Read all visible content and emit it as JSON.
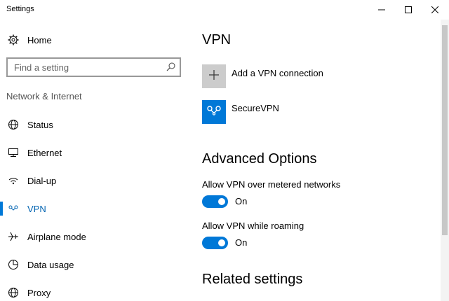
{
  "window": {
    "title": "Settings",
    "minimize_icon": "minimize-icon",
    "maximize_icon": "maximize-icon",
    "close_icon": "close-icon"
  },
  "sidebar": {
    "home_label": "Home",
    "search_placeholder": "Find a setting",
    "section_title": "Network & Internet",
    "items": [
      {
        "label": "Status",
        "icon": "globe-icon"
      },
      {
        "label": "Ethernet",
        "icon": "monitor-icon"
      },
      {
        "label": "Dial-up",
        "icon": "dialup-icon"
      },
      {
        "label": "VPN",
        "icon": "vpn-icon",
        "active": true
      },
      {
        "label": "Airplane mode",
        "icon": "airplane-icon"
      },
      {
        "label": "Data usage",
        "icon": "data-usage-icon"
      },
      {
        "label": "Proxy",
        "icon": "globe-icon"
      }
    ]
  },
  "main": {
    "title": "VPN",
    "add_label": "Add a VPN connection",
    "connection_name": "SecureVPN",
    "advanced_title": "Advanced Options",
    "options": [
      {
        "label": "Allow VPN over metered networks",
        "state": "On"
      },
      {
        "label": "Allow VPN while roaming",
        "state": "On"
      }
    ],
    "related_title": "Related settings"
  },
  "colors": {
    "accent": "#0078d7",
    "tile_gray": "#cccccc"
  }
}
